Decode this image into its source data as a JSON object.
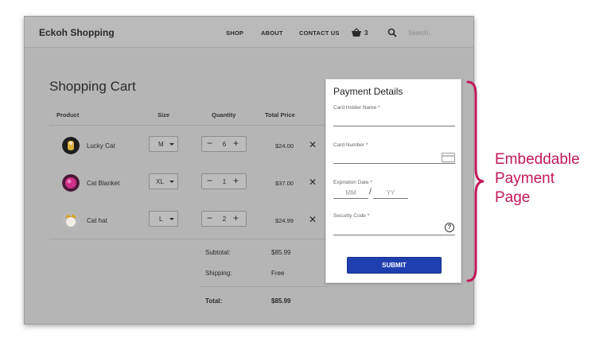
{
  "navbar": {
    "brand": "Eckoh Shopping",
    "links": [
      "SHOP",
      "ABOUT",
      "CONTACT US"
    ],
    "cart_count": "3",
    "search_placeholder": "Search..."
  },
  "cart": {
    "title": "Shopping Cart",
    "headers": {
      "product": "Product",
      "size": "Size",
      "quantity": "Quantity",
      "total_price": "Total Price"
    },
    "rows": [
      {
        "name": "Lucky Cat",
        "size": "M",
        "qty": "6",
        "price": "$24.00"
      },
      {
        "name": "Cat Blanket",
        "size": "XL",
        "qty": "1",
        "price": "$37.00"
      },
      {
        "name": "Cat hat",
        "size": "L",
        "qty": "2",
        "price": "$24.99"
      }
    ],
    "summary": {
      "subtotal_label": "Subtotal:",
      "subtotal_value": "$85.99",
      "shipping_label": "Shipping:",
      "shipping_value": "Free",
      "total_label": "Total:",
      "total_value": "$85.99"
    }
  },
  "payment": {
    "title": "Payment Details",
    "card_holder_label": "Card Holder Name *",
    "card_number_label": "Card Number *",
    "expiration_label": "Expiration Date *",
    "month_placeholder": "MM",
    "year_placeholder": "YY",
    "separator": "/",
    "security_label": "Security Code *",
    "help_glyph": "?",
    "submit_label": "SUBMIT"
  },
  "callout": {
    "lines": [
      "Embeddable",
      "Payment",
      "Page"
    ],
    "color": "#c2185b"
  },
  "colors": {
    "submit_button": "#1f3fb0",
    "overlay": "#b5b5b5"
  }
}
